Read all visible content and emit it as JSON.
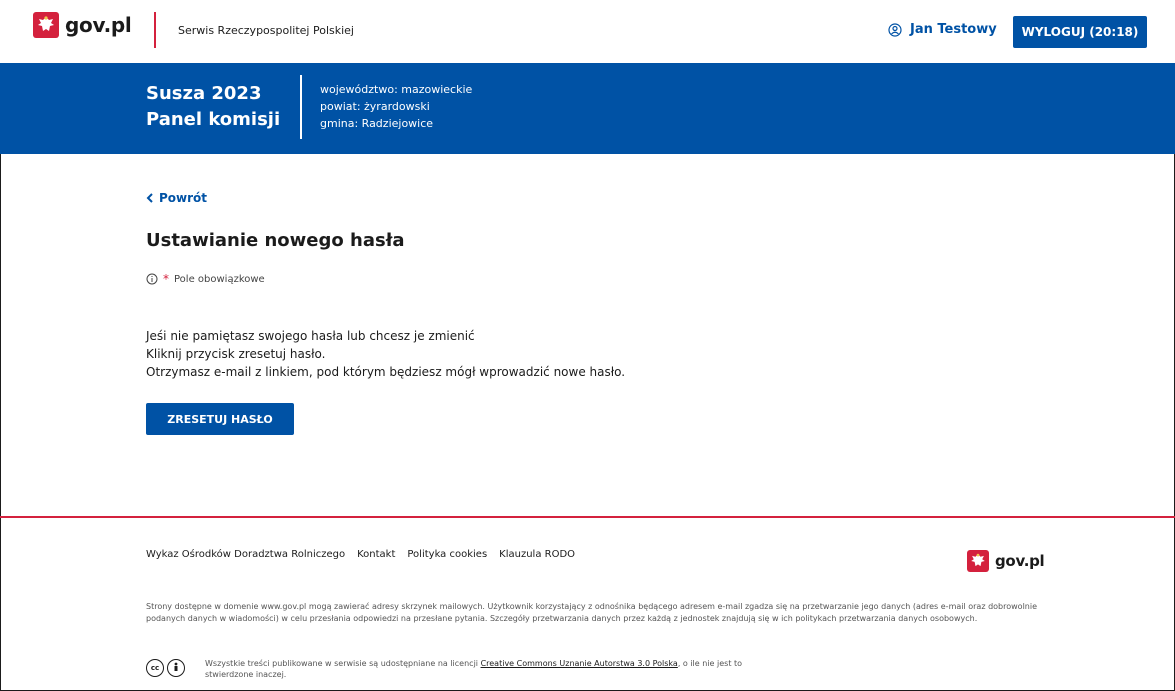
{
  "header": {
    "logo_text": "gov.pl",
    "service_name": "Serwis Rzeczypospolitej Polskiej",
    "user_name": "Jan Testowy",
    "logout_label": "WYLOGUJ (20:18)"
  },
  "banner": {
    "title_line1": "Susza 2023",
    "title_line2": "Panel komisji",
    "region_voivodeship": "województwo: mazowieckie",
    "region_county": "powiat: żyrardowski",
    "region_commune": "gmina: Radziejowice"
  },
  "main": {
    "back_label": "Powrót",
    "page_title": "Ustawianie nowego hasła",
    "required_star": "*",
    "required_note": "Pole obowiązkowe",
    "info_line1": "Jeśi nie pamiętasz swojego hasła lub chcesz je zmienić",
    "info_line2": "Kliknij przycisk zresetuj hasło.",
    "info_line3": "Otrzymasz e-mail z linkiem, pod którym będziesz mógł wprowadzić nowe hasło.",
    "reset_label": "ZRESETUJ HASŁO"
  },
  "footer": {
    "links": [
      "Wykaz Ośrodków Doradztwa Rolniczego",
      "Kontakt",
      "Polityka cookies",
      "Klauzula RODO"
    ],
    "logo_text": "gov.pl",
    "disclaimer": "Strony dostępne w domenie www.gov.pl mogą zawierać adresy skrzynek mailowych. Użytkownik korzystający z odnośnika będącego adresem e-mail zgadza się na przetwarzanie jego danych (adres e-mail oraz dobrowolnie podanych danych w wiadomości) w celu przesłania odpowiedzi na przesłane pytania. Szczegóły przetwarzania danych przez każdą z jednostek znajdują się w ich politykach przetwarzania danych osobowych.",
    "cc_icon_label": "cc",
    "license_prefix": "Wszystkie treści publikowane w serwisie są udostępniane na licencji",
    "license_link": "Creative Commons Uznanie Autorstwa 3.0 Polska",
    "license_suffix": ", o ile nie jest to stwierdzone inaczej."
  },
  "colors": {
    "primary_blue": "#0052a5",
    "accent_red": "#d4213d"
  },
  "icons": [
    "poland-eagle-icon",
    "user-circle-icon",
    "chevron-left-icon",
    "info-icon",
    "cc-icon",
    "by-icon"
  ]
}
